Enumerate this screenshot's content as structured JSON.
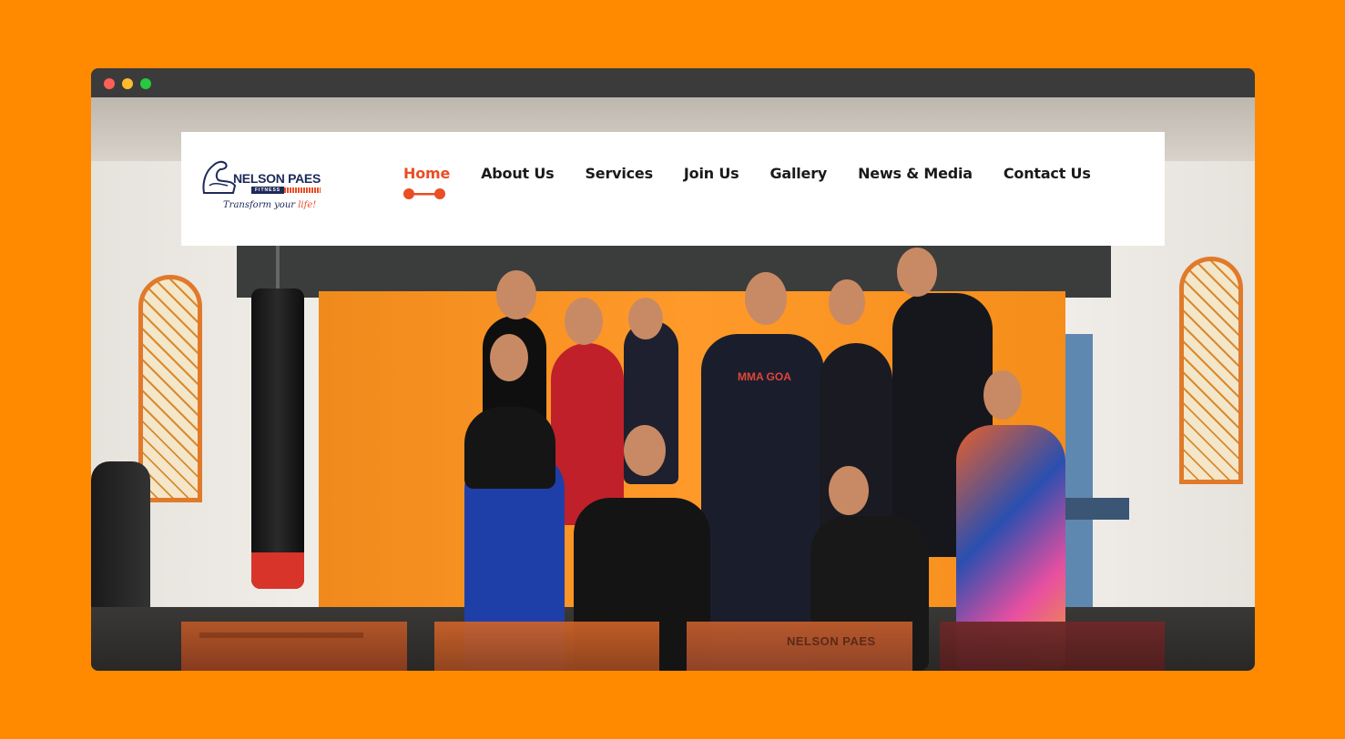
{
  "window": {
    "controls": [
      "close",
      "minimize",
      "maximize"
    ]
  },
  "logo": {
    "brand": "NELSON PAES",
    "sub": "FITNESS",
    "tagline_start": "Transform your ",
    "tagline_end": "life!"
  },
  "nav": {
    "items": [
      {
        "label": "Home",
        "active": true
      },
      {
        "label": "About Us"
      },
      {
        "label": "Services"
      },
      {
        "label": "Join Us"
      },
      {
        "label": "Gallery"
      },
      {
        "label": "News & Media"
      },
      {
        "label": "Contact Us"
      }
    ]
  },
  "hero": {
    "shirt_text": "MMA GOA"
  },
  "thumbnails": [
    {
      "label": ""
    },
    {
      "label": ""
    },
    {
      "label": "NELSON PAES"
    },
    {
      "label": ""
    }
  ],
  "colors": {
    "page_bg": "#ff8a00",
    "accent": "#e94e24",
    "brand_navy": "#1e2a5a"
  }
}
